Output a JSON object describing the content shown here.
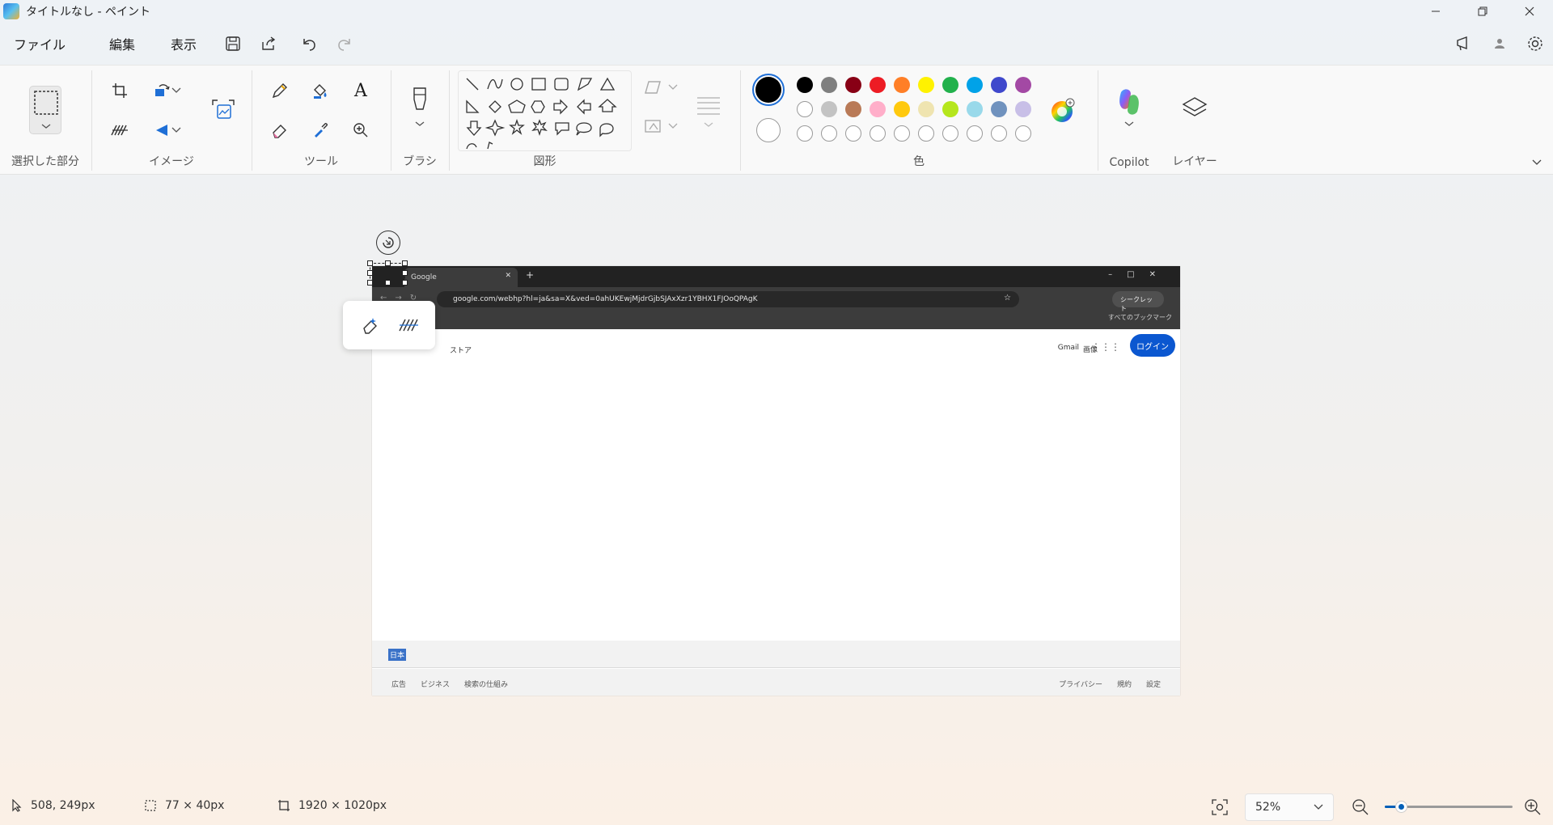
{
  "window": {
    "title": "タイトルなし - ペイント",
    "controls": [
      "minimize-icon",
      "restore-icon",
      "close-icon"
    ]
  },
  "menu": {
    "file": "ファイル",
    "edit": "編集",
    "view": "表示",
    "icons": [
      "save-icon",
      "share-icon",
      "undo-icon",
      "redo-icon"
    ],
    "right_icons": [
      "feedback-icon",
      "account-icon",
      "settings-icon"
    ]
  },
  "ribbon": {
    "selection_label": "選択した部分",
    "image_label": "イメージ",
    "tools_label": "ツール",
    "brush_label": "ブラシ",
    "shapes_label": "図形",
    "colors_label": "色",
    "copilot_label": "Copilot",
    "layers_label": "レイヤー",
    "text_tool": "A"
  },
  "colors": {
    "active_primary": "#000000",
    "active_secondary": "#ffffff",
    "row1": [
      "#000000",
      "#7f7f7f",
      "#880015",
      "#ed1c24",
      "#ff7f27",
      "#fff200",
      "#22b14c",
      "#00a2e8",
      "#3f48cc",
      "#a349a4"
    ],
    "row2": [
      "#ffffff",
      "#c3c3c3",
      "#b97a57",
      "#ffaec9",
      "#ffc90e",
      "#efe4b0",
      "#b5e61d",
      "#99d9ea",
      "#7092be",
      "#c8bfe7"
    ],
    "row3_count_label": ""
  },
  "canvas_content": {
    "tab_title": "Google",
    "url": "google.com/webhp?hl=ja&sa=X&ved=0ahUKEwjMjdrGjbSJAxXzr1YBHX1FJOoQPAgK",
    "incognito": "シークレット",
    "bookmarks": "すべてのブックマーク",
    "store": "ストア",
    "gmail": "Gmail",
    "images": "画像",
    "login": "ログイン",
    "country": "日本",
    "footer_left": [
      "広告",
      "ビジネス",
      "検索の仕組み"
    ],
    "footer_right": [
      "プライバシー",
      "規約",
      "設定"
    ]
  },
  "status": {
    "cursor_position": "508, 249px",
    "selection_size": "77 × 40px",
    "canvas_size": "1920 × 1020px",
    "zoom": "52%",
    "zoom_fraction": 0.13
  }
}
